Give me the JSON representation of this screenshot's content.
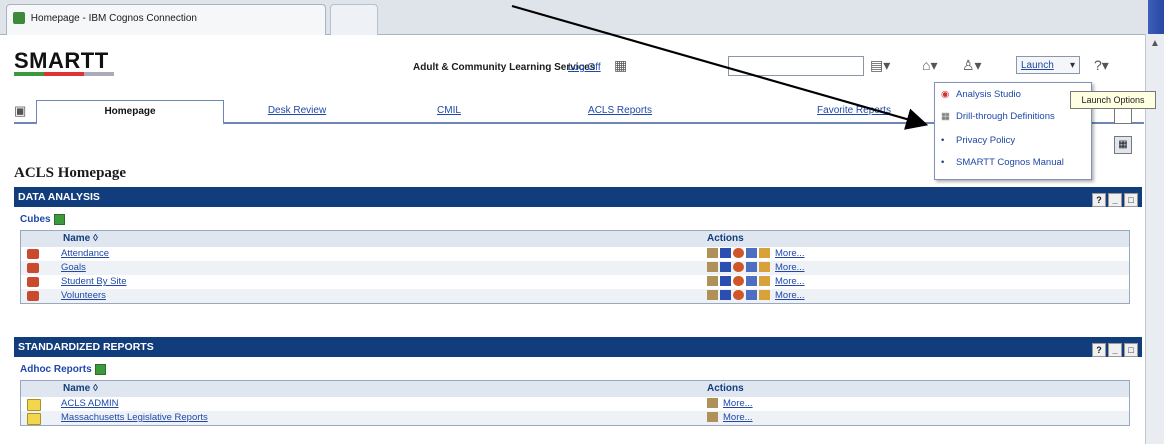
{
  "browser": {
    "tab_title": "Homepage - IBM Cognos Connection"
  },
  "header": {
    "logo": "SMARTT",
    "org": "Adult & Community Learning Services",
    "logoff": "Log Off",
    "search_value": "",
    "launch_label": "Launch"
  },
  "tabs": [
    "Homepage",
    "Desk Review",
    "CMIL",
    "ACLS Reports",
    "Favorite Reports"
  ],
  "launch_menu": {
    "items": [
      "Analysis Studio",
      "Drill-through Definitions",
      "Privacy Policy",
      "SMARTT Cognos Manual"
    ],
    "tooltip": "Launch Options"
  },
  "page_title": "ACLS Homepage",
  "sections": [
    {
      "title": "DATA ANALYSIS",
      "subheading": "Cubes",
      "col_name": "Name ◊",
      "col_actions": "Actions",
      "rows": [
        {
          "name": "Attendance",
          "more": "More..."
        },
        {
          "name": "Goals",
          "more": "More..."
        },
        {
          "name": "Student By Site",
          "more": "More..."
        },
        {
          "name": "Volunteers",
          "more": "More..."
        }
      ]
    },
    {
      "title": "STANDARDIZED REPORTS",
      "subheading": "Adhoc Reports",
      "col_name": "Name ◊",
      "col_actions": "Actions",
      "rows": [
        {
          "name": "ACLS ADMIN",
          "more": "More..."
        },
        {
          "name": "Massachusetts Legislative Reports",
          "more": "More..."
        }
      ]
    }
  ],
  "section_buttons": [
    "?",
    "_",
    "□"
  ],
  "colors": {
    "section_bar": "#123d7d",
    "link": "#1f48a8"
  }
}
